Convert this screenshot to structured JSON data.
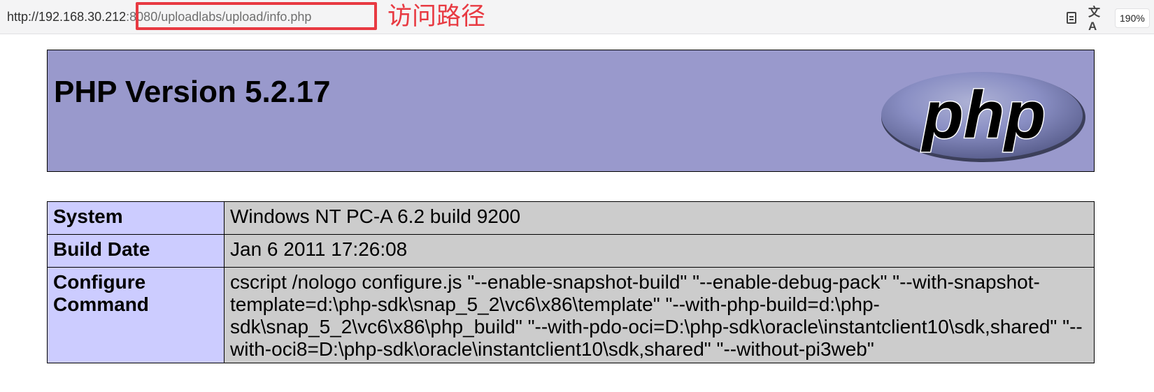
{
  "browser": {
    "url_host": "http://192.168.30.212",
    "url_path": ":8080/uploadlabs/upload/info.php",
    "annotation": "访问路径",
    "zoom": "190%",
    "translate_glyph": "文A"
  },
  "php": {
    "title": "PHP Version 5.2.17",
    "logo_text": "php"
  },
  "info_table": {
    "rows": [
      {
        "key": "System",
        "value": "Windows NT PC-A 6.2 build 9200"
      },
      {
        "key": "Build Date",
        "value": "Jan 6 2011 17:26:08"
      },
      {
        "key": "Configure Command",
        "value": "cscript /nologo configure.js \"--enable-snapshot-build\" \"--enable-debug-pack\" \"--with-snapshot-template=d:\\php-sdk\\snap_5_2\\vc6\\x86\\template\" \"--with-php-build=d:\\php-sdk\\snap_5_2\\vc6\\x86\\php_build\" \"--with-pdo-oci=D:\\php-sdk\\oracle\\instantclient10\\sdk,shared\" \"--with-oci8=D:\\php-sdk\\oracle\\instantclient10\\sdk,shared\" \"--without-pi3web\""
      }
    ]
  },
  "colors": {
    "header_bg": "#9999cc",
    "key_bg": "#ccccff",
    "value_bg": "#cccccc",
    "annotation": "#e83a42"
  }
}
